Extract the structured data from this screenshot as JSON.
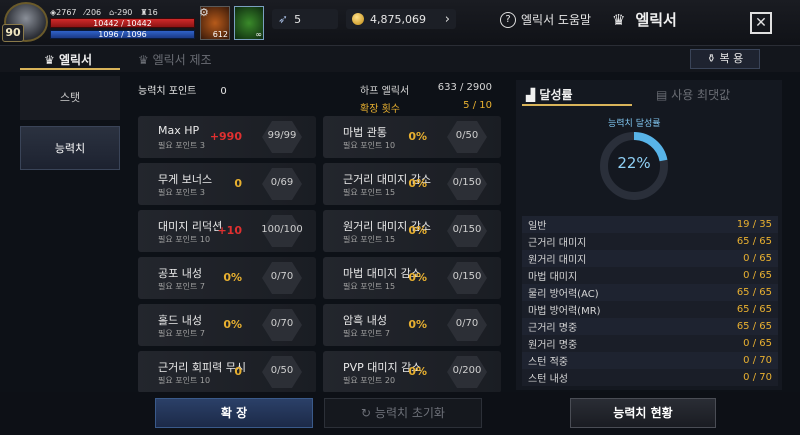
{
  "player": {
    "level": "90",
    "stat1": "2767",
    "stat2": "206",
    "stat3": "-290",
    "stat4": "16",
    "hp": "10442 / 10442",
    "mp": "1096 / 1096"
  },
  "slots": {
    "a_count": "612",
    "b_count": "∞"
  },
  "resources": {
    "wings": "5",
    "gold": "4,875,069"
  },
  "header": {
    "help": "엘릭서 도움말",
    "title": "엘릭서",
    "close": "✕"
  },
  "tabs": {
    "elixir": "엘릭서",
    "craft": "엘릭서 제조",
    "restore": "복 용"
  },
  "side": {
    "stat": "스탯",
    "ability": "능력치"
  },
  "points": {
    "label": "능력치 포인트",
    "value": "0"
  },
  "harp": {
    "label": "하프 엘릭서",
    "value": "633 / 2900",
    "expand_label": "확장 횟수",
    "expand_value": "5 / 10"
  },
  "left_cards": [
    {
      "name": "Max HP",
      "req": "필요 포인트 3",
      "bonus": "+990",
      "level": "99/99",
      "red": true
    },
    {
      "name": "무게 보너스",
      "req": "필요 포인트 3",
      "bonus": "0",
      "level": "0/69",
      "red": false
    },
    {
      "name": "대미지 리덕션",
      "req": "필요 포인트 10",
      "bonus": "+10",
      "level": "100/100",
      "red": true
    },
    {
      "name": "공포 내성",
      "req": "필요 포인트 7",
      "bonus": "0%",
      "level": "0/70",
      "red": false
    },
    {
      "name": "홀드 내성",
      "req": "필요 포인트 7",
      "bonus": "0%",
      "level": "0/70",
      "red": false
    },
    {
      "name": "근거리 회피력 무시",
      "req": "필요 포인트 10",
      "bonus": "0",
      "level": "0/50",
      "red": false
    }
  ],
  "mid_cards": [
    {
      "name": "마법 관통",
      "req": "필요 포인트 10",
      "bonus": "0%",
      "level": "0/50"
    },
    {
      "name": "근거리 대미지 감소",
      "req": "필요 포인트 15",
      "bonus": "0%",
      "level": "0/150"
    },
    {
      "name": "원거리 대미지 감소",
      "req": "필요 포인트 15",
      "bonus": "0%",
      "level": "0/150"
    },
    {
      "name": "마법 대미지 감소",
      "req": "필요 포인트 15",
      "bonus": "0%",
      "level": "0/150"
    },
    {
      "name": "암흑 내성",
      "req": "필요 포인트 7",
      "bonus": "0%",
      "level": "0/70"
    },
    {
      "name": "PVP 대미지 감소",
      "req": "필요 포인트 20",
      "bonus": "0%",
      "level": "0/200"
    }
  ],
  "achievement": {
    "tab1": "달성률",
    "tab2": "사용 최댓값",
    "ring_label": "능력치 달성률",
    "percent": "22%",
    "percent_value": 22,
    "rows": [
      {
        "k": "일반",
        "v": "19 / 35"
      },
      {
        "k": "근거리 대미지",
        "v": "65 / 65"
      },
      {
        "k": "원거리 대미지",
        "v": "0 / 65"
      },
      {
        "k": "마법 대미지",
        "v": "0 / 65"
      },
      {
        "k": "물리 방어력(AC)",
        "v": "65 / 65"
      },
      {
        "k": "마법 방어력(MR)",
        "v": "65 / 65"
      },
      {
        "k": "근거리 명중",
        "v": "65 / 65"
      },
      {
        "k": "원거리 명중",
        "v": "0 / 65"
      },
      {
        "k": "스턴 적중",
        "v": "0 / 70"
      },
      {
        "k": "스턴 내성",
        "v": "0 / 70"
      }
    ]
  },
  "buttons": {
    "expand": "확 장",
    "reset": "능력치 초기화",
    "status": "능력치 현황"
  },
  "colors": {
    "accent": "#d9b45a",
    "value": "#e8b030",
    "red": "#e03030",
    "ring": "#58b4e8"
  }
}
